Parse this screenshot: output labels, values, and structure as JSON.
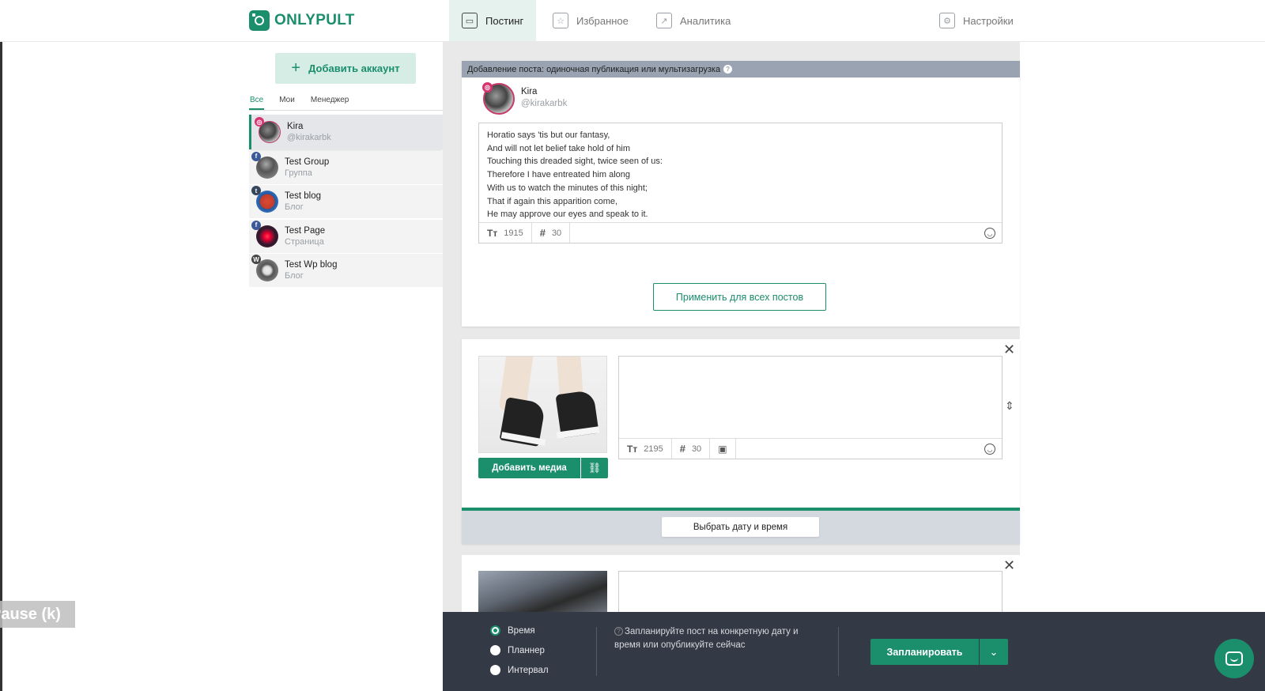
{
  "app": {
    "logo_text": "ONLYPULT",
    "brand_color": "#1b8e6c"
  },
  "nav": {
    "posting": "Постинг",
    "favorites": "Избранное",
    "analytics": "Аналитика",
    "settings": "Настройки"
  },
  "sidebar": {
    "add_account": "Добавить аккаунт",
    "filters": [
      "Все",
      "Мои",
      "Менеджер"
    ],
    "accounts": [
      {
        "name": "Kira",
        "sub": "@kirakarbk",
        "network": "instagram"
      },
      {
        "name": "Test Group",
        "sub": "Группа",
        "network": "facebook"
      },
      {
        "name": "Test blog",
        "sub": "Блог",
        "network": "tumblr"
      },
      {
        "name": "Test Page",
        "sub": "Страница",
        "network": "facebook"
      },
      {
        "name": "Test Wp blog",
        "sub": "Блог",
        "network": "wordpress"
      }
    ]
  },
  "post_editor": {
    "header": "Добавление поста: одиночная публикация или мультизагрузка",
    "account_name": "Kira",
    "account_handle": "@kirakarbk",
    "text_lines": [
      "Horatio says 'tis but our fantasy,",
      "And will not let belief take hold of him",
      "Touching this dreaded sight, twice seen of us:",
      "Therefore I have entreated him along",
      "With us to watch the minutes of this night;",
      "That if again this apparition come,",
      "He may approve our eyes and speak to it."
    ],
    "char_count": "1915",
    "hashtag_count": "30",
    "apply_all": "Применить для всех постов"
  },
  "post_item": {
    "char_count": "2195",
    "hashtag_count": "30",
    "add_media": "Добавить медиа",
    "pick_datetime": "Выбрать дату и время"
  },
  "bottom": {
    "options": [
      "Время",
      "Планнер",
      "Интервал"
    ],
    "selected": "Время",
    "hint": "Запланируйте пост на конкретную дату и время или опубликуйте сейчас",
    "schedule": "Запланировать"
  },
  "overlay": {
    "pause": "Pause (k)"
  }
}
